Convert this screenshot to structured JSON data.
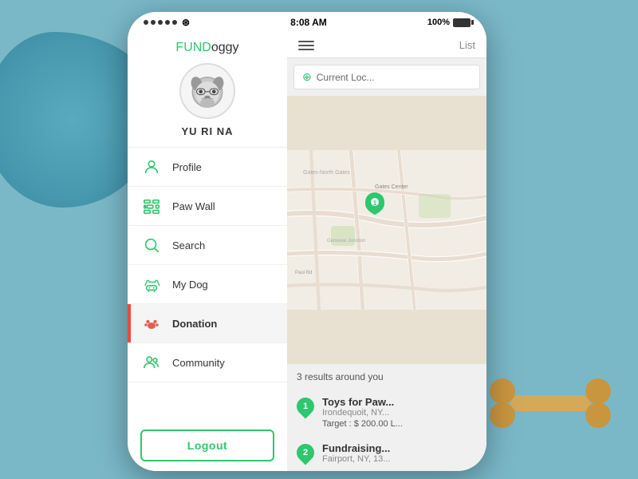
{
  "statusBar": {
    "dots": 5,
    "wifi": "wifi",
    "time": "8:08 AM",
    "battery": "100%"
  },
  "app": {
    "logo_fund": "FUND",
    "logo_oggy": "oggy",
    "logoFull": "FUNDoggy"
  },
  "user": {
    "name": "YU RI NA"
  },
  "menu": {
    "items": [
      {
        "id": "profile",
        "label": "Profile",
        "icon": "person",
        "active": false
      },
      {
        "id": "paw-wall",
        "label": "Paw Wall",
        "icon": "wall",
        "active": false
      },
      {
        "id": "search",
        "label": "Search",
        "icon": "search",
        "active": false
      },
      {
        "id": "my-dog",
        "label": "My Dog",
        "icon": "dog",
        "active": false
      },
      {
        "id": "donation",
        "label": "Donation",
        "icon": "paw",
        "active": true
      },
      {
        "id": "community",
        "label": "Community",
        "icon": "community",
        "active": false
      }
    ],
    "logout_label": "Logout"
  },
  "rightPanel": {
    "list_tab": "List",
    "location_placeholder": "Current Loc...",
    "results_count": "3 results around you",
    "results": [
      {
        "number": "1",
        "title": "Toys for Paw...",
        "subtitle": "Irondequoit, NY...",
        "target": "Target : $ 200.00 L..."
      },
      {
        "number": "2",
        "title": "Fundraising...",
        "subtitle": "Fairport, NY, 13..."
      }
    ]
  }
}
